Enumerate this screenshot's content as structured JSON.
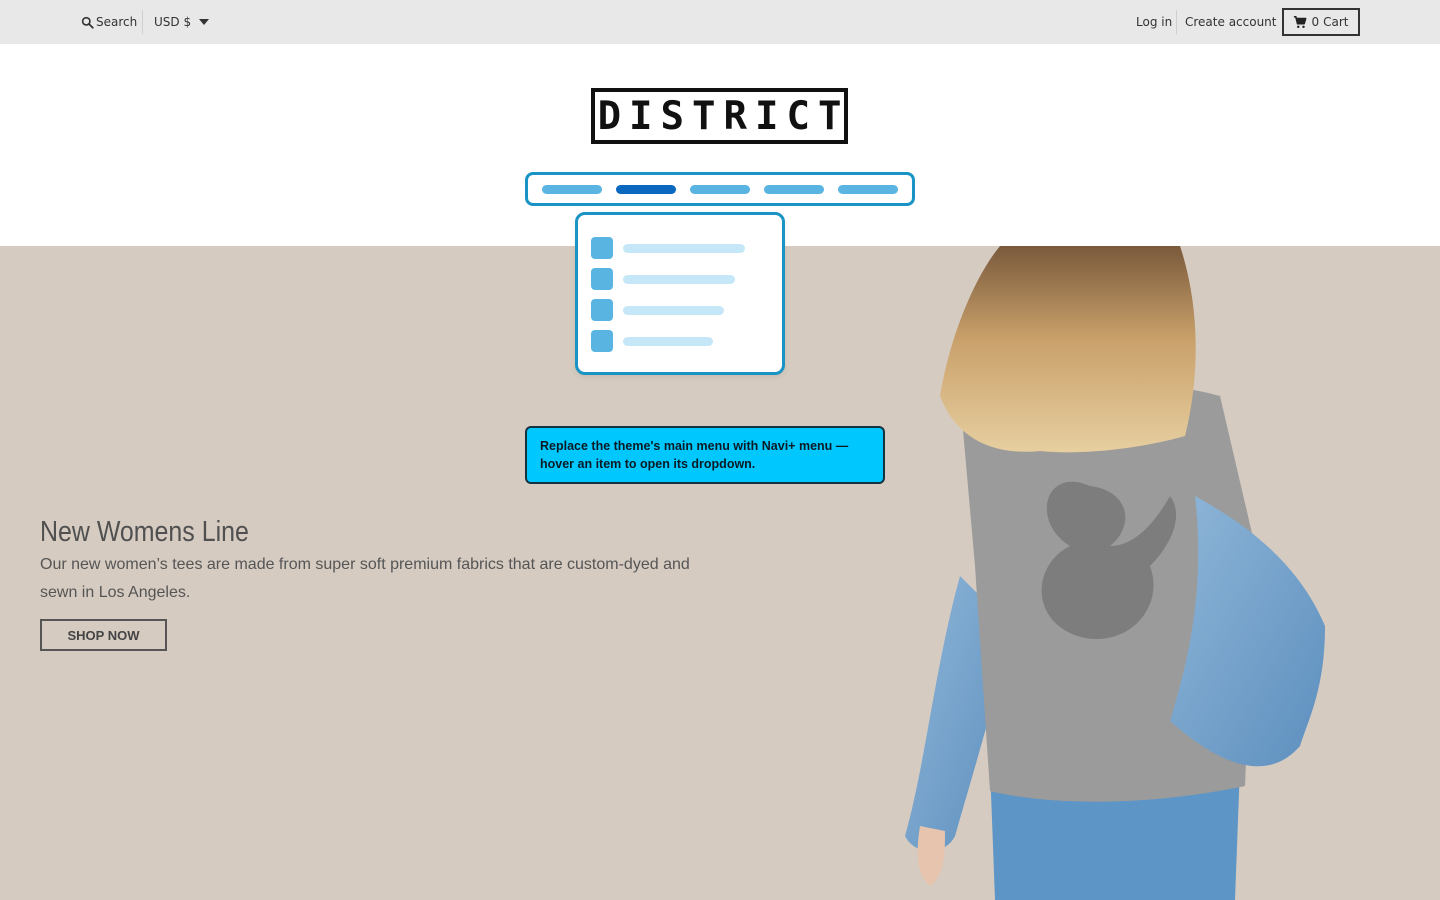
{
  "topbar": {
    "search_label": "Search",
    "currency_label": "USD $",
    "login_label": "Log in",
    "create_account_label": "Create account",
    "cart_count": "0",
    "cart_label": "Cart"
  },
  "header": {
    "logo_text": "DISTRICT"
  },
  "navi_menu": {
    "pills": 5,
    "active_index": 1,
    "dropdown_rows": 4,
    "accent_color": "#1a93c5",
    "pill_color": "#5ab4e2",
    "active_pill_color": "#0a68be"
  },
  "callout": {
    "text_line1": "Replace the theme's main menu with Navi+ menu —",
    "text_line2": "hover an item to open its dropdown.",
    "background_color": "#00c8ff"
  },
  "hero": {
    "title": "New Womens Line",
    "description": "Our new women’s tees are made from super soft premium fabrics that are custom-dyed and sewn in Los Angeles.",
    "button_label": "SHOP NOW",
    "background_color": "#d5cbc1"
  },
  "icons": {
    "search": "search-icon",
    "currency_caret": "chevron-down-icon",
    "cart": "cart-icon"
  }
}
